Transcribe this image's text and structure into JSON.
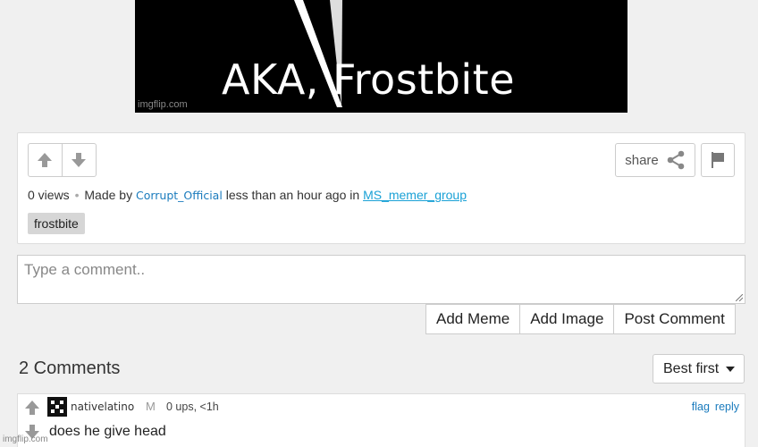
{
  "meme": {
    "caption": "AKA, Frostbite",
    "watermark": "imgflip.com"
  },
  "post": {
    "upvote_icon": "arrow-up-icon",
    "downvote_icon": "arrow-down-icon",
    "share_label": "share",
    "share_icon": "share-icon",
    "flag_icon": "flag-icon",
    "views": "0 views",
    "made_by": "Made by",
    "author": "Corrupt_Official",
    "time_text": "less than an hour ago in",
    "stream": "MS_memer_group",
    "tag": "frostbite"
  },
  "comment_form": {
    "placeholder": "Type a comment..",
    "add_meme": "Add Meme",
    "add_image": "Add Image",
    "post_comment": "Post Comment"
  },
  "comments_header": {
    "count_label": "2 Comments",
    "sort_value": "Best first"
  },
  "comments": [
    {
      "user": "nativelatino",
      "gender": "M",
      "meta": "0 ups, <1h",
      "flag": "flag",
      "reply": "reply",
      "text": "does he give head"
    }
  ],
  "footer": {
    "watermark": "imgflip.com"
  },
  "colors": {
    "link": "#1a7bbd",
    "stream_link": "#1aa1d6",
    "background": "#f0f0f0"
  }
}
